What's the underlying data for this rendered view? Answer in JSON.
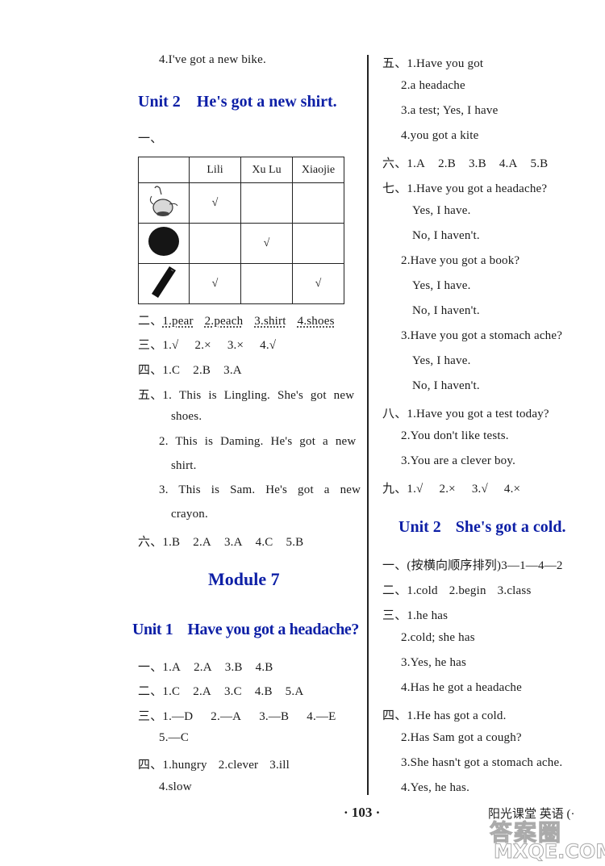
{
  "page_number": "103",
  "page_number_dots": [
    "·",
    "·"
  ],
  "book_title": "阳光课堂  英语  (·",
  "watermark": {
    "line1": "答案圈",
    "line2": "MXQE.COM"
  },
  "left_column": {
    "top_line": "4.I've got a new bike.",
    "unit2_heading": {
      "unit": "Unit 2",
      "title": "He's got a new shirt."
    },
    "section1_label": "一、",
    "table": {
      "headers": [
        "",
        "Lili",
        "Xu Lu",
        "Xiaojie"
      ],
      "rows": [
        {
          "item_icon": "pear-icon",
          "marks": [
            "√",
            "",
            ""
          ]
        },
        {
          "item_icon": "ball-icon",
          "marks": [
            "",
            "√",
            ""
          ]
        },
        {
          "item_icon": "crayon-icon",
          "marks": [
            "√",
            "",
            "√"
          ]
        }
      ]
    },
    "section2": {
      "label": "二、",
      "answers": [
        "1.pear",
        "2.peach",
        "3.shirt",
        "4.shoes"
      ]
    },
    "section3": {
      "label": "三、",
      "answers": [
        "1.√",
        "2.×",
        "3.×",
        "4.√"
      ]
    },
    "section4": {
      "label": "四、",
      "answers": [
        "1.C",
        "2.B",
        "3.A"
      ]
    },
    "section5": {
      "label": "五、",
      "lines": [
        "1. This is Lingling. She's got new",
        "shoes.",
        "2. This is Daming. He's got a new",
        "shirt.",
        "3. This is Sam. He's got a new",
        "crayon."
      ]
    },
    "section6": {
      "label": "六、",
      "answers": [
        "1.B",
        "2.A",
        "3.A",
        "4.C",
        "5.B"
      ]
    },
    "module7_heading": "Module 7",
    "unit1_heading": {
      "unit": "Unit 1",
      "title": "Have you got a headache?"
    },
    "m7u1": {
      "s1": {
        "label": "一、",
        "answers": [
          "1.A",
          "2.A",
          "3.B",
          "4.B"
        ]
      },
      "s2": {
        "label": "二、",
        "answers": [
          "1.C",
          "2.A",
          "3.C",
          "4.B",
          "5.A"
        ]
      },
      "s3": {
        "label": "三、",
        "answers": [
          "1.—D",
          "2.—A",
          "3.—B",
          "4.—E"
        ],
        "cont": "5.—C"
      },
      "s4": {
        "label": "四、",
        "answers": [
          "1.hungry",
          "2.clever",
          "3.ill"
        ],
        "cont": "4.slow"
      }
    }
  },
  "right_column": {
    "s5": {
      "label": "五、",
      "lines": [
        "1.Have you got",
        "2.a headache",
        "3.a test; Yes, I have",
        "4.you got a kite"
      ]
    },
    "s6": {
      "label": "六、",
      "answers": [
        "1.A",
        "2.B",
        "3.B",
        "4.A",
        "5.B"
      ]
    },
    "s7": {
      "label": "七、",
      "items": [
        {
          "q": "1.Have you got a headache?",
          "yes": "Yes, I have.",
          "no": "No, I haven't."
        },
        {
          "q": "2.Have you got a book?",
          "yes": "Yes, I have.",
          "no": "No, I haven't."
        },
        {
          "q": "3.Have you got a stomach ache?",
          "yes": "Yes, I have.",
          "no": "No, I haven't."
        }
      ]
    },
    "s8": {
      "label": "八、",
      "lines": [
        "1.Have you got a test today?",
        "2.You don't like tests.",
        "3.You are a clever boy."
      ]
    },
    "s9": {
      "label": "九、",
      "answers": [
        "1.√",
        "2.×",
        "3.√",
        "4.×"
      ]
    },
    "unit2_heading": {
      "unit": "Unit 2",
      "title": "She's got a cold."
    },
    "u2": {
      "s1": {
        "label": "一、",
        "text": "(按横向顺序排列)3—1—4—2"
      },
      "s2": {
        "label": "二、",
        "answers": [
          "1.cold",
          "2.begin",
          "3.class"
        ]
      },
      "s3": {
        "label": "三、",
        "lines": [
          "1.he has",
          "2.cold; she has",
          "3.Yes, he has",
          "4.Has he got a headache"
        ]
      },
      "s4": {
        "label": "四、",
        "lines": [
          "1.He has got a cold.",
          "2.Has Sam got a cough?",
          "3.She hasn't got a stomach ache.",
          "4.Yes, he has."
        ]
      }
    }
  }
}
